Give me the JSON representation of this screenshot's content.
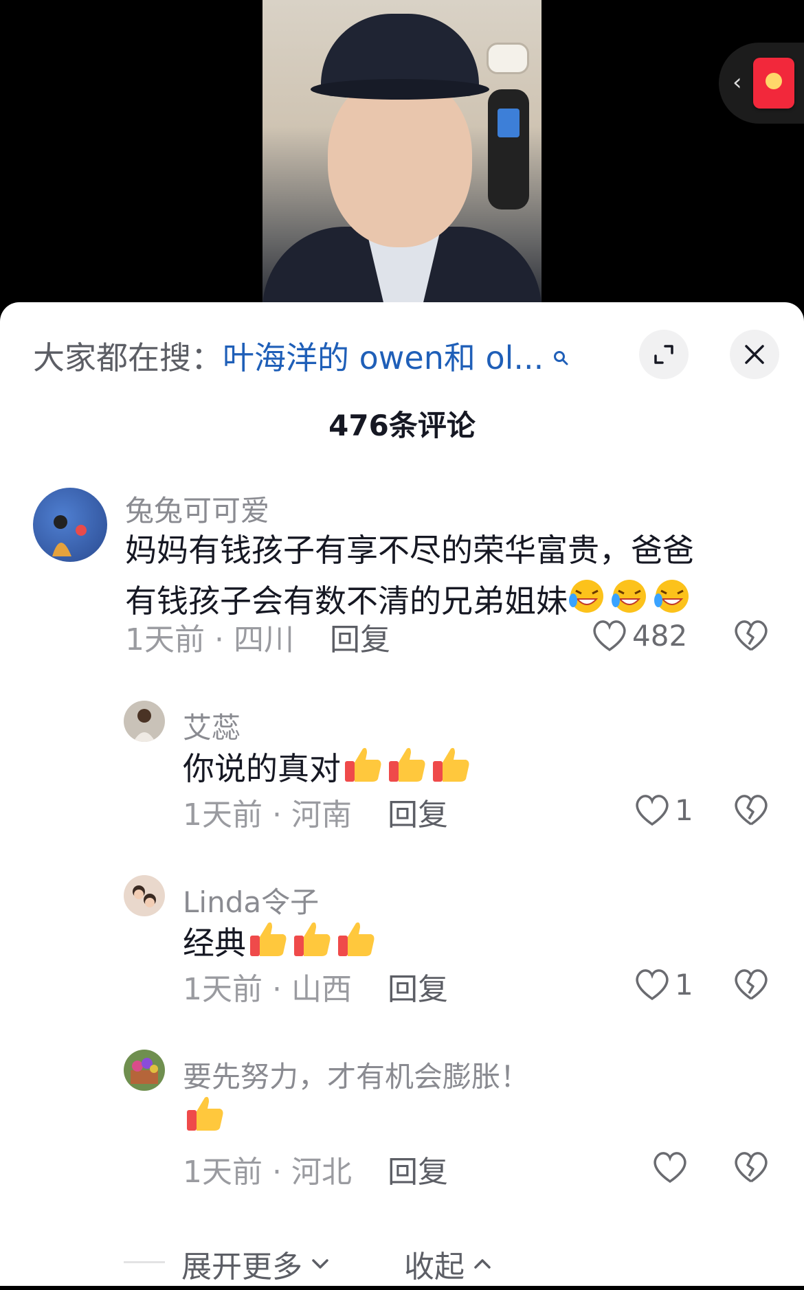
{
  "search": {
    "prefix": "大家都在搜：",
    "query": "叶海洋的 owen和 ol..."
  },
  "comment_count": "476条评论",
  "comments": [
    {
      "username": "兔兔可可爱",
      "text": "妈妈有钱孩子有享不尽的荣华富贵，爸爸有钱孩子会有数不清的兄弟姐妹",
      "line1": "妈妈有钱孩子有享不尽的荣华富贵，爸爸",
      "line2": "有钱孩子会有数不清的兄弟姐妹",
      "emoji": "laughing-crying-emoji x3",
      "meta": "1天前 · 四川",
      "reply": "回复",
      "likes": "482"
    },
    {
      "username": "艾蕊",
      "text": "你说的真对",
      "emoji": "thumbs-up-emoji x3",
      "meta": "1天前 · 河南",
      "reply": "回复",
      "likes": "1"
    },
    {
      "username": "Linda令子",
      "text": "经典",
      "emoji": "thumbs-up-emoji x3",
      "meta": "1天前 · 山西",
      "reply": "回复",
      "likes": "1"
    },
    {
      "username": "要先努力，才有机会膨胀！",
      "text": "",
      "emoji": "thumbs-up-emoji x1",
      "meta": "1天前 · 河北",
      "reply": "回复",
      "likes": ""
    }
  ],
  "footer": {
    "expand_more": "展开更多",
    "collapse": "收起"
  },
  "colors": {
    "link": "#1f5fb8",
    "muted": "#8a8b91",
    "text": "#161823",
    "redpack": "#f2283b"
  },
  "icons": [
    "search-icon",
    "expand-icon",
    "close-icon",
    "heart-icon",
    "broken-heart-icon",
    "chevron-left-icon",
    "red-packet-icon",
    "chevron-down-icon",
    "chevron-up-icon"
  ]
}
